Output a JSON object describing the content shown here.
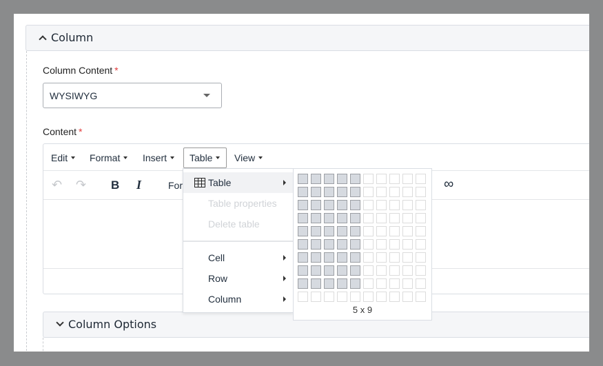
{
  "column_panel": {
    "title": "Column"
  },
  "column_content": {
    "label": "Column Content",
    "required": "*",
    "value": "WYSIWYG"
  },
  "content": {
    "label": "Content",
    "required": "*"
  },
  "editor": {
    "menubar": [
      {
        "label": "Edit"
      },
      {
        "label": "Format"
      },
      {
        "label": "Insert"
      },
      {
        "label": "Table"
      },
      {
        "label": "View"
      }
    ],
    "toolbar": {
      "undo": "↶",
      "redo": "↷",
      "bold": "B",
      "italic": "I",
      "format_partial": "For",
      "link": "∞"
    }
  },
  "table_menu": {
    "items": [
      {
        "label": "Table",
        "enabled": true,
        "submenu": true
      },
      {
        "label": "Table properties",
        "enabled": false
      },
      {
        "label": "Delete table",
        "enabled": false
      },
      {
        "label": "Cell",
        "enabled": true,
        "submenu": true
      },
      {
        "label": "Row",
        "enabled": true,
        "submenu": true
      },
      {
        "label": "Column",
        "enabled": true,
        "submenu": true
      }
    ]
  },
  "table_grid": {
    "columns": 10,
    "rows": 10,
    "selected_cols": 5,
    "selected_rows": 9,
    "label": "5 x 9"
  },
  "options_panel": {
    "title": "Column Options"
  }
}
